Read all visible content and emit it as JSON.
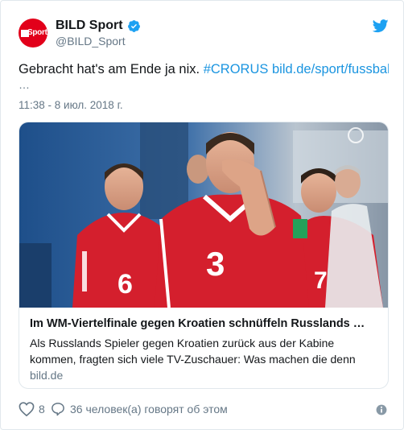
{
  "author": {
    "display_name": "BILD Sport",
    "handle": "@BILD_Sport",
    "avatar_text": "Sport",
    "verified": true
  },
  "tweet": {
    "text_plain": "Gebracht hat's am Ende ja nix.",
    "hashtag": "#CRORUS",
    "link": "bild.de/sport/fussball",
    "ellipsis": "…",
    "timestamp": "11:38 - 8 июл. 2018 г."
  },
  "card": {
    "title": "Im WM-Viertelfinale gegen Kroatien schnüffeln Russlands …",
    "description": "Als Russlands Spieler gegen Kroatien zurück aus der Kabine kommen, fragten sich viele TV-Zuschauer: Was machen die denn",
    "domain": "bild.de",
    "image_jersey_numbers": [
      "6",
      "3",
      "7"
    ]
  },
  "footer": {
    "like_count": "8",
    "conversation_text": "36 человек(а) говорят об этом"
  },
  "icons": [
    "verified-badge-icon",
    "twitter-bird-icon",
    "heart-icon",
    "speech-bubble-icon",
    "info-icon"
  ],
  "colors": {
    "accent": "#1da1f2",
    "link": "#1b95e0",
    "muted": "#657786",
    "bild_red": "#e2001a",
    "jersey_red": "#d41f2d"
  }
}
